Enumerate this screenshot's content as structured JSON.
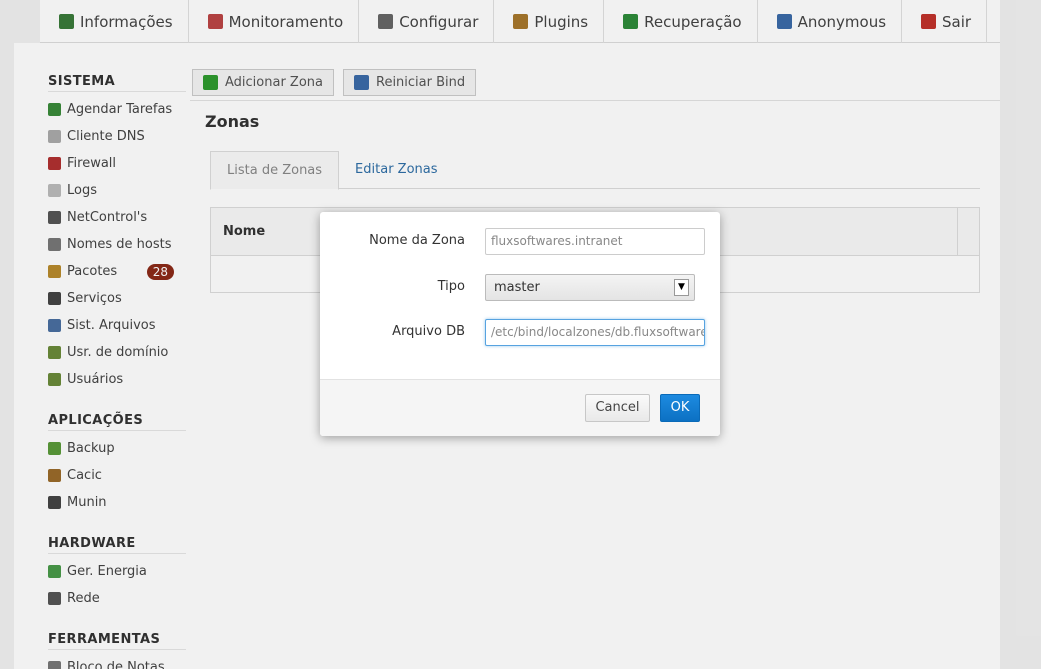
{
  "topnav": {
    "items": [
      {
        "label": "Informações",
        "icon": "chart-icon",
        "color": "#3a7a3a"
      },
      {
        "label": "Monitoramento",
        "icon": "pulse-icon",
        "color": "#b44"
      },
      {
        "label": "Configurar",
        "icon": "tools-icon",
        "color": "#666"
      },
      {
        "label": "Plugins",
        "icon": "box-icon",
        "color": "#a7772c"
      },
      {
        "label": "Recuperação",
        "icon": "restore-icon",
        "color": "#2e8b3a"
      },
      {
        "label": "Anonymous",
        "icon": "user-icon",
        "color": "#3b6aa8"
      },
      {
        "label": "Sair",
        "icon": "close-icon",
        "color": "#c0322b"
      }
    ]
  },
  "sidebar": {
    "sections": [
      {
        "title": "SISTEMA",
        "items": [
          {
            "label": "Agendar Tarefas",
            "icon": "clock-icon",
            "color": "#3a8a3a"
          },
          {
            "label": "Cliente DNS",
            "icon": "book-icon",
            "color": "#aaa"
          },
          {
            "label": "Firewall",
            "icon": "wall-icon",
            "color": "#b03030"
          },
          {
            "label": "Logs",
            "icon": "document-icon",
            "color": "#bbb"
          },
          {
            "label": "NetControl's",
            "icon": "monitor-icon",
            "color": "#555"
          },
          {
            "label": "Nomes de hosts",
            "icon": "network-icon",
            "color": "#777"
          },
          {
            "label": "Pacotes",
            "icon": "package-icon",
            "color": "#b88a2c",
            "badge": "28"
          },
          {
            "label": "Serviços",
            "icon": "server-icon",
            "color": "#444"
          },
          {
            "label": "Sist. Arquivos",
            "icon": "disk-icon",
            "color": "#4a6fa0"
          },
          {
            "label": "Usr. de domínio",
            "icon": "users-icon",
            "color": "#6a8a3a"
          },
          {
            "label": "Usuários",
            "icon": "users-icon",
            "color": "#6a8a3a"
          }
        ]
      },
      {
        "title": "APLICAÇÕES",
        "items": [
          {
            "label": "Backup",
            "icon": "backup-icon",
            "color": "#5a9a3a"
          },
          {
            "label": "Cacic",
            "icon": "chest-icon",
            "color": "#9a6a2a"
          },
          {
            "label": "Munin",
            "icon": "graph-icon",
            "color": "#444"
          }
        ]
      },
      {
        "title": "HARDWARE",
        "items": [
          {
            "label": "Ger. Energia",
            "icon": "battery-icon",
            "color": "#4a9a4a"
          },
          {
            "label": "Rede",
            "icon": "network-card-icon",
            "color": "#555"
          }
        ]
      },
      {
        "title": "FERRAMENTAS",
        "items": [
          {
            "label": "Bloco de Notas",
            "icon": "notepad-icon",
            "color": "#777"
          }
        ]
      }
    ]
  },
  "toolbar": {
    "add_zone_label": "Adicionar Zona",
    "add_zone_icon_color": "#2e9a2e",
    "restart_bind_label": "Reiniciar Bind",
    "restart_bind_icon_color": "#3b6aa8"
  },
  "page": {
    "title": "Zonas",
    "tabs": [
      {
        "label": "Lista de Zonas",
        "active": true
      },
      {
        "label": "Editar Zonas",
        "active": false
      }
    ],
    "table": {
      "columns": [
        "Nome"
      ]
    }
  },
  "modal": {
    "zone_name_label": "Nome da Zona",
    "zone_name_value": "fluxsoftwares.intranet",
    "type_label": "Tipo",
    "type_value": "master",
    "db_file_label": "Arquivo DB",
    "db_file_value": "/etc/bind/localzones/db.fluxsoftwares.intranet",
    "cancel_label": "Cancel",
    "ok_label": "OK"
  }
}
